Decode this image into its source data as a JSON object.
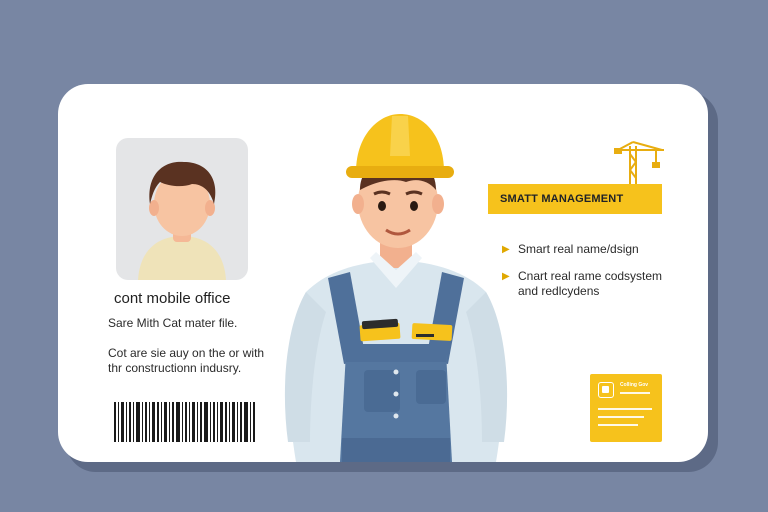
{
  "card": {
    "office_label": "cont mobile office",
    "line1": "Sare Mith Cat mater file.",
    "paragraph": [
      "Cot are sie auy on the or with",
      "thr constructionn indusry."
    ]
  },
  "banner": {
    "title": "SMATT MANAGEMENT"
  },
  "bullets": [
    {
      "lines": [
        "Smart real name/dsign"
      ]
    },
    {
      "lines": [
        "Cnart real rame codsystem",
        "and redlcydens"
      ]
    }
  ],
  "doc_card": {
    "title": "Colling Gov"
  },
  "colors": {
    "background": "#7886a3",
    "accent_yellow": "#f6c21c",
    "card": "#ffffff",
    "overalls": "#5577a0"
  },
  "icons": [
    "person-avatar-icon",
    "construction-crane-icon",
    "barcode-icon",
    "document-icon",
    "arrow-bullet-icon"
  ]
}
